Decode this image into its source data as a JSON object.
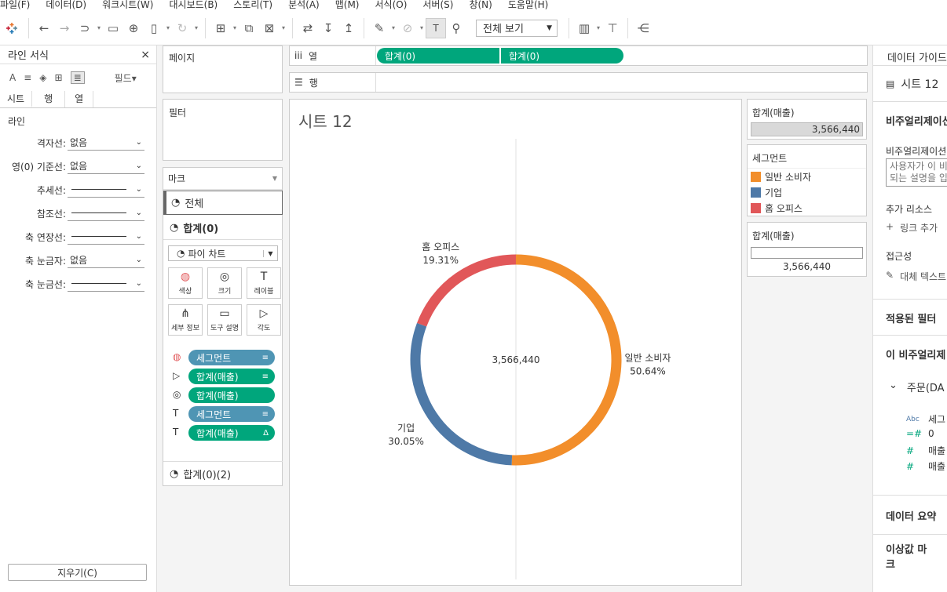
{
  "menu": [
    "파일(F)",
    "데이터(D)",
    "워크시트(W)",
    "대시보드(B)",
    "스토리(T)",
    "분석(A)",
    "맵(M)",
    "서식(O)",
    "서버(S)",
    "창(N)",
    "도움말(H)"
  ],
  "toolbar": {
    "view_label": "전체 보기"
  },
  "left_panel": {
    "title": "라인 서식",
    "field_label": "필드▾",
    "tabs": [
      "시트",
      "행",
      "열"
    ],
    "section": "라인",
    "rows": [
      {
        "label": "격자선:",
        "value": "없음"
      },
      {
        "label": "영(0) 기준선:",
        "value": "없음"
      },
      {
        "label": "추세선:",
        "value": ""
      },
      {
        "label": "참조선:",
        "value": ""
      },
      {
        "label": "축 연장선:",
        "value": ""
      },
      {
        "label": "축 눈금자:",
        "value": "없음"
      },
      {
        "label": "축 눈금선:",
        "value": ""
      }
    ],
    "clear_button": "지우기(C)"
  },
  "pages_label": "페이지",
  "filters_label": "필터",
  "marks": {
    "title": "마크",
    "all_label": "전체",
    "group_label": "합계(0)",
    "chart_type": "파이 차트",
    "buttons": [
      "색상",
      "크기",
      "레이블",
      "세부 정보",
      "도구 설명",
      "각도"
    ],
    "pills": [
      {
        "label": "세그먼트",
        "kind": "blue"
      },
      {
        "label": "합계(매출)",
        "kind": "green"
      },
      {
        "label": "합계(매출)",
        "kind": "green"
      },
      {
        "label": "세그먼트",
        "kind": "blue"
      },
      {
        "label": "합계(매출)",
        "kind": "green"
      }
    ],
    "group2_label": "합계(0)(2)"
  },
  "shelves": {
    "columns_label": "열",
    "rows_label": "행",
    "col_pills": [
      "합계(0)",
      "합계(0)"
    ]
  },
  "sheet": {
    "title": "시트 12",
    "center_label": "3,566,440"
  },
  "chart_data": {
    "type": "pie",
    "categories": [
      "일반 소비자",
      "기업",
      "홈 오피스"
    ],
    "values": [
      50.64,
      30.05,
      19.31
    ],
    "value_labels": [
      "50.64%",
      "30.05%",
      "19.31%"
    ],
    "total": "3,566,440",
    "colors": [
      "#f28e2b",
      "#4e79a7",
      "#e15759"
    ]
  },
  "legend1": {
    "title": "합계(매출)",
    "value": "3,566,440"
  },
  "legend2": {
    "title": "세그먼트",
    "items": [
      "일반 소비자",
      "기업",
      "홈 오피스"
    ]
  },
  "legend3": {
    "title": "합계(매출)",
    "value": "3,566,440"
  },
  "right_panel": {
    "title": "데이터 가이드",
    "sheet_label": "시트 12",
    "viz_section": "비주얼리제이션",
    "viz_sub": "비주얼리제이션",
    "desc_line1": "사용자가 이 비",
    "desc_line2": "되는 설명을 입",
    "resources": "추가 리소스",
    "add_link": "링크 추가",
    "access": "접근성",
    "alt_text": "대체 텍스트",
    "applied_filters": "적용된 필터",
    "this_viz": "이 비주얼리제",
    "order_label": "주문(DA",
    "fields": [
      {
        "icon": "Abc",
        "label": "세그"
      },
      {
        "icon": "=#",
        "label": "0"
      },
      {
        "icon": "#",
        "label": "매출"
      },
      {
        "icon": "#",
        "label": "매출"
      }
    ],
    "data_summary": "데이터 요약",
    "outliers": "이상값 마크"
  }
}
